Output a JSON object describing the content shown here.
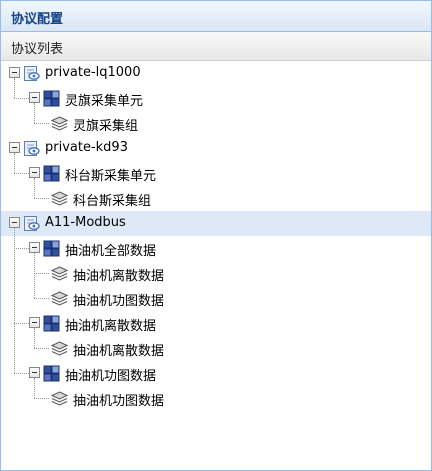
{
  "panel": {
    "title": "协议配置"
  },
  "grid": {
    "column_header": "协议列表"
  },
  "tree": {
    "selected": "A11-Modbus",
    "nodes": [
      {
        "level": 0,
        "type": "protocol",
        "icon": "protocol-icon",
        "label": "private-lq1000",
        "expanded": true
      },
      {
        "level": 1,
        "type": "unit",
        "icon": "cubes-icon",
        "label": "灵旗采集单元",
        "expanded": true
      },
      {
        "level": 2,
        "type": "group",
        "icon": "layers-icon",
        "label": "灵旗采集组"
      },
      {
        "level": 0,
        "type": "protocol",
        "icon": "protocol-icon",
        "label": "private-kd93",
        "expanded": true
      },
      {
        "level": 1,
        "type": "unit",
        "icon": "cubes-icon",
        "label": "科台斯采集单元",
        "expanded": true
      },
      {
        "level": 2,
        "type": "group",
        "icon": "layers-icon",
        "label": "科台斯采集组"
      },
      {
        "level": 0,
        "type": "protocol",
        "icon": "protocol-icon",
        "label": "A11-Modbus",
        "expanded": true
      },
      {
        "level": 1,
        "type": "unit",
        "icon": "cubes-icon",
        "label": "抽油机全部数据",
        "expanded": true
      },
      {
        "level": 2,
        "type": "group",
        "icon": "layers-icon",
        "label": "抽油机离散数据"
      },
      {
        "level": 2,
        "type": "group",
        "icon": "layers-icon",
        "label": "抽油机功图数据"
      },
      {
        "level": 1,
        "type": "unit",
        "icon": "cubes-icon",
        "label": "抽油机离散数据",
        "expanded": true
      },
      {
        "level": 2,
        "type": "group",
        "icon": "layers-icon",
        "label": "抽油机离散数据"
      },
      {
        "level": 1,
        "type": "unit",
        "icon": "cubes-icon",
        "label": "抽油机功图数据",
        "expanded": true
      },
      {
        "level": 2,
        "type": "group",
        "icon": "layers-icon",
        "label": "抽油机功图数据"
      }
    ]
  },
  "colors": {
    "header_title": "#15428b",
    "border": "#99bbe8",
    "selected_row": "#dfe8f6"
  }
}
